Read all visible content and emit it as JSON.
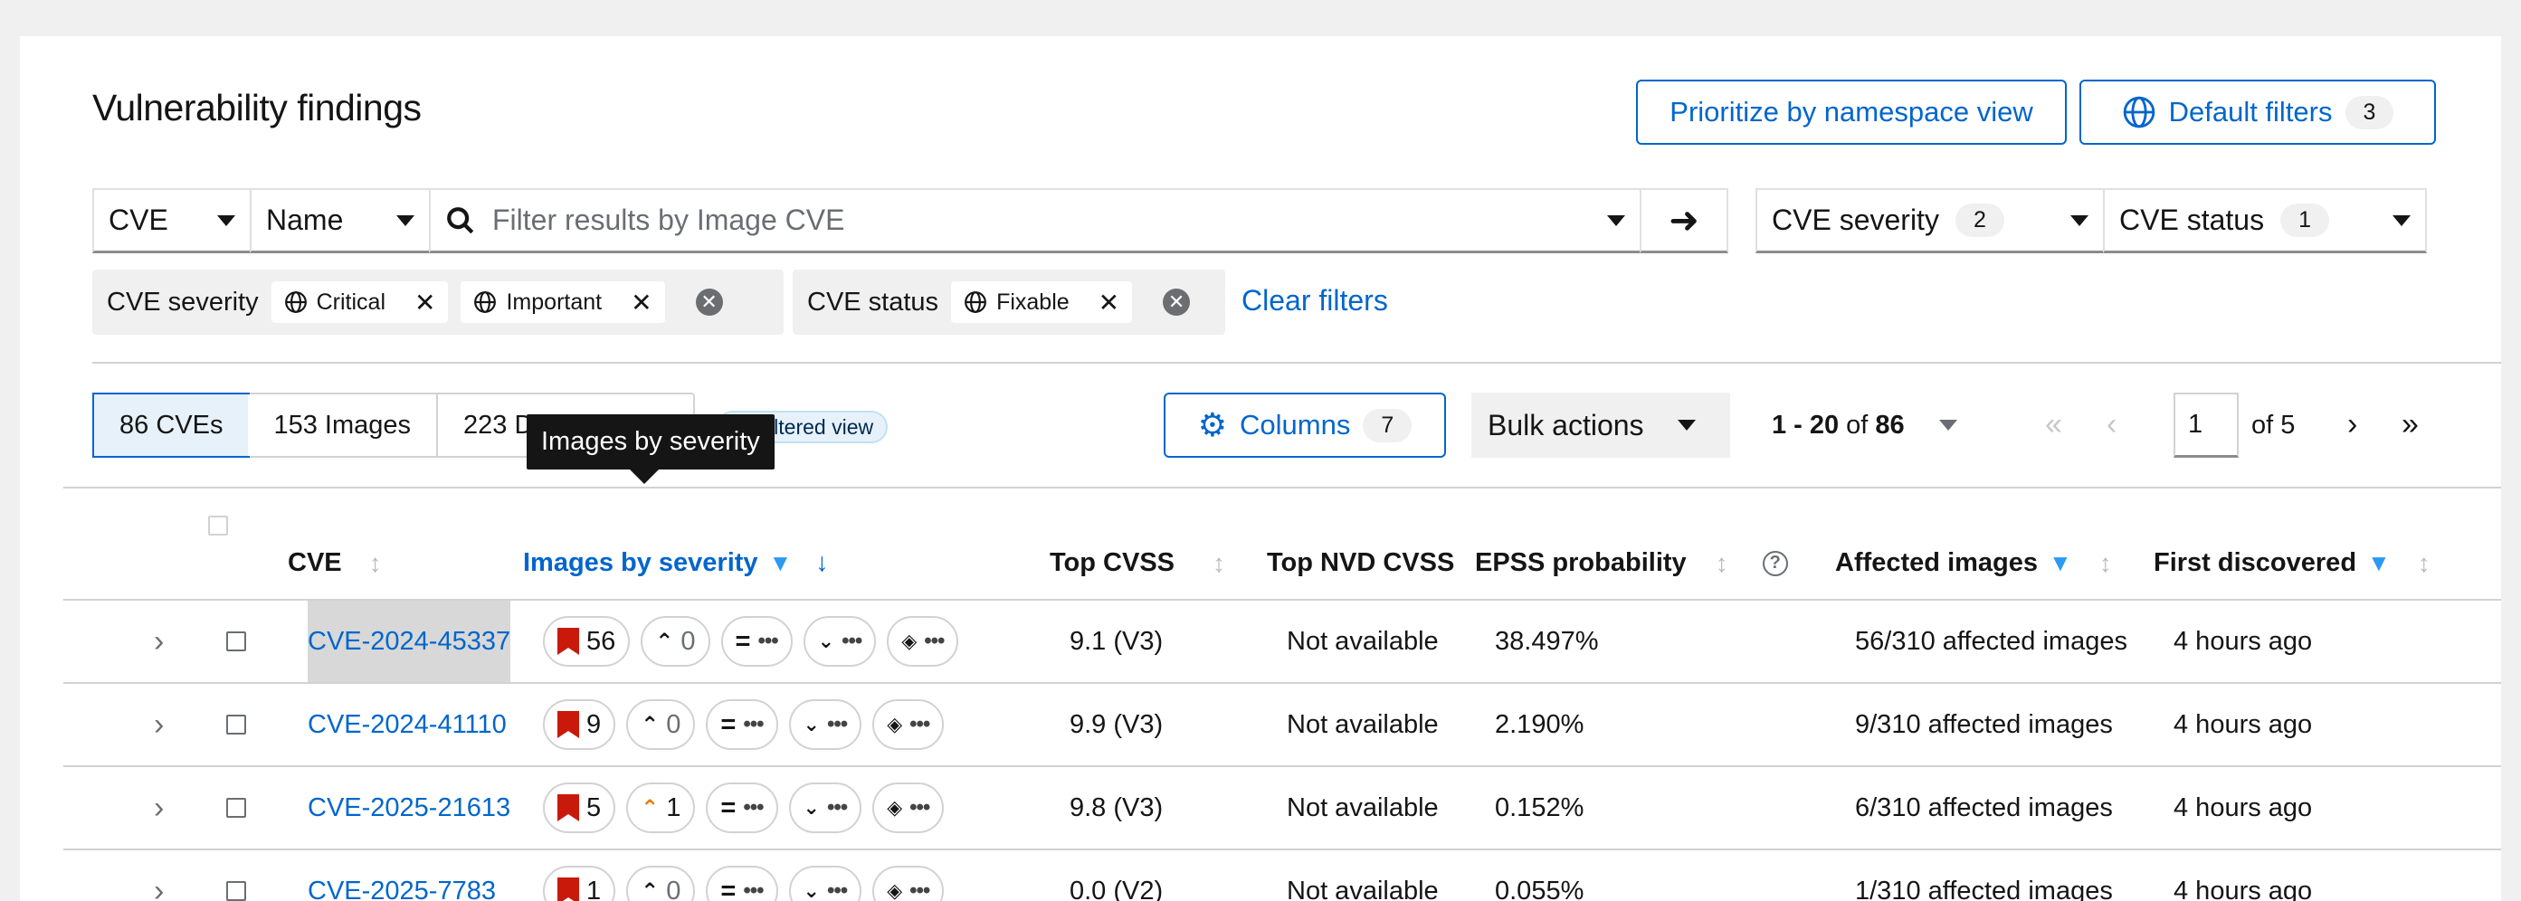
{
  "header": {
    "title": "Vulnerability findings",
    "prioritize_label": "Prioritize by namespace view",
    "default_filters_label": "Default filters",
    "default_filters_count": "3"
  },
  "search": {
    "attribute": "CVE",
    "field": "Name",
    "placeholder": "Filter results by Image CVE",
    "severity_label": "CVE severity",
    "severity_count": "2",
    "status_label": "CVE status",
    "status_count": "1"
  },
  "chips": {
    "severity_group": "CVE severity",
    "severity_values": [
      "Critical",
      "Important"
    ],
    "status_group": "CVE status",
    "status_values": [
      "Fixable"
    ],
    "clear_label": "Clear filters"
  },
  "toolbar": {
    "tabs": [
      "86 CVEs",
      "153 Images",
      "223 Deployments"
    ],
    "filtered_view": "Filtered view",
    "tooltip": "Images by severity",
    "columns_label": "Columns",
    "columns_count": "7",
    "bulk_label": "Bulk actions",
    "range_prefix": "1 - 20",
    "range_of": "of",
    "range_total": "86",
    "page_value": "1",
    "page_of": "of 5"
  },
  "table": {
    "headers": {
      "cve": "CVE",
      "images_by_severity": "Images by severity",
      "top_cvss": "Top CVSS",
      "top_nvd": "Top NVD CVSS",
      "epss": "EPSS probability",
      "affected": "Affected images",
      "first_discovered": "First discovered"
    },
    "rows": [
      {
        "cve": "CVE-2024-45337",
        "critical": "56",
        "important": "0",
        "cvss": "9.1 (V3)",
        "nvd": "Not available",
        "epss": "38.497%",
        "affected": "56/310 affected images",
        "discovered": "4 hours ago"
      },
      {
        "cve": "CVE-2024-41110",
        "critical": "9",
        "important": "0",
        "cvss": "9.9 (V3)",
        "nvd": "Not available",
        "epss": "2.190%",
        "affected": "9/310 affected images",
        "discovered": "4 hours ago"
      },
      {
        "cve": "CVE-2025-21613",
        "critical": "5",
        "important": "1",
        "cvss": "9.8 (V3)",
        "nvd": "Not available",
        "epss": "0.152%",
        "affected": "6/310 affected images",
        "discovered": "4 hours ago"
      },
      {
        "cve": "CVE-2025-7783",
        "critical": "1",
        "important": "0",
        "cvss": "0.0 (V2)",
        "nvd": "Not available",
        "epss": "0.055%",
        "affected": "1/310 affected images",
        "discovered": "4 hours ago"
      }
    ]
  },
  "colors": {
    "accent": "#0066cc",
    "critical": "#c9190b",
    "important": "#ec7a08"
  }
}
